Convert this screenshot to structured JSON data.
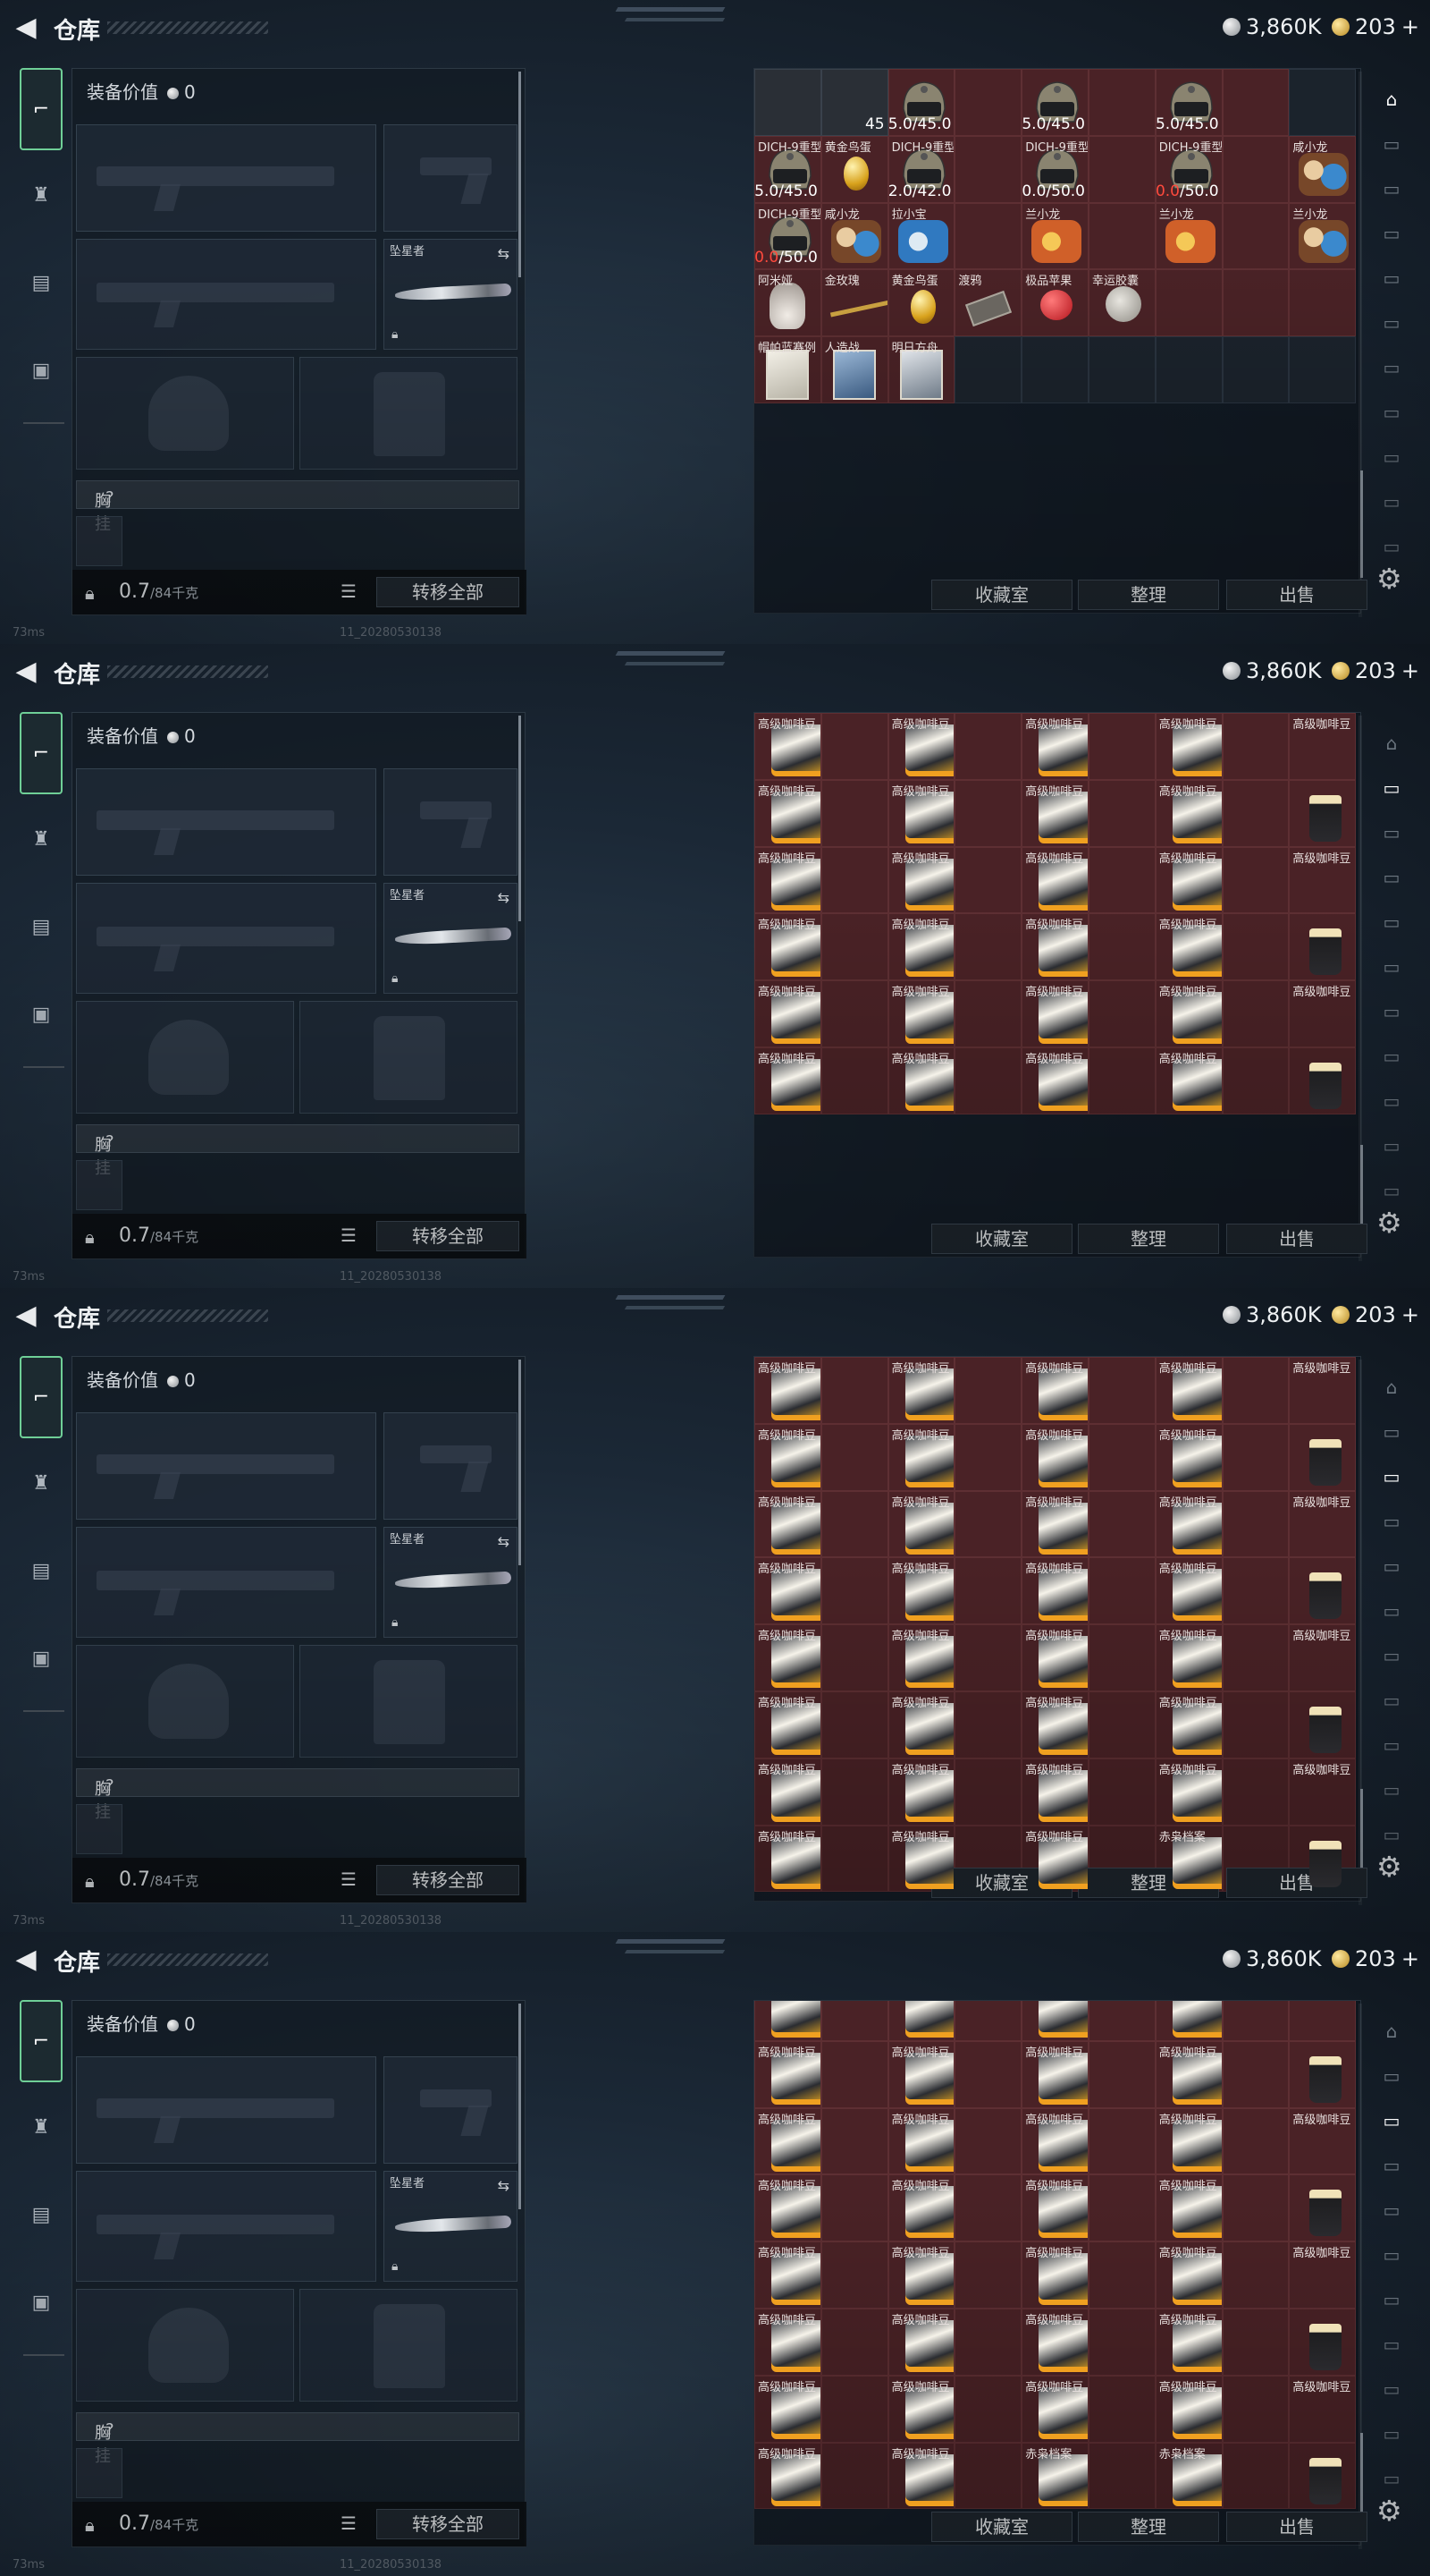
{
  "header": {
    "title": "仓库",
    "silver": "3,860K",
    "gold": "203"
  },
  "equip": {
    "value_label": "装备价值",
    "value": "0",
    "melee_label": "坠星者",
    "chest_label": "胸挂",
    "chest_mark": "?",
    "weight_current": "0.7",
    "weight_max": "/84千克",
    "transfer_label": "转移全部"
  },
  "stash_buttons": {
    "collection": "收藏室",
    "organize": "整理",
    "sell": "出售"
  },
  "status": {
    "ping": "73ms",
    "build": "11_20280530138"
  },
  "icons": {
    "back": "back-arrow-icon",
    "gun": "gun-icon",
    "armor": "armor-icon",
    "backpack": "backpack-icon",
    "case": "case-icon",
    "settings": "gear-icon",
    "lock": "lock-icon",
    "swap": "swap-icon",
    "list": "list-icon"
  },
  "colors": {
    "item_bg": "#4a2226",
    "active_tab": "#6fcf97"
  },
  "frames": [
    {
      "grid": [
        {
          "label": "",
          "item": "dark"
        },
        {
          "label": "",
          "count": "45",
          "item": "dark"
        },
        {
          "label": "",
          "count": "45.0/45.0",
          "item": "helmet"
        },
        {
          "label": "",
          "count": "",
          "item": "cont"
        },
        {
          "label": "",
          "count": "45.0/45.0",
          "item": "helmet"
        },
        {
          "label": "",
          "count": "",
          "item": "cont"
        },
        {
          "label": "",
          "count": "45.0/45.0",
          "item": "helmet"
        },
        {
          "label": "",
          "count": "",
          "item": "cont"
        },
        {
          "label": "",
          "item": "empty"
        },
        {
          "label": "DICH-9重型头盔 三角洲",
          "count": "45.0/45.0",
          "item": "helmet"
        },
        {
          "label": "黄金鸟蛋",
          "item": "egg"
        },
        {
          "label": "DICH-9重型头盔 三角洲",
          "count": "42.0/42.0",
          "item": "helmet"
        },
        {
          "label": "",
          "item": "cont"
        },
        {
          "label": "DICH-9重型头盔 三角洲",
          "count": "30.0/50.0",
          "item": "helmet"
        },
        {
          "label": "",
          "item": "cont"
        },
        {
          "label": "DICH-9重型头盔 三角洲",
          "count_red": "10.0",
          "count": "/50.0",
          "item": "helmet"
        },
        {
          "label": "",
          "item": "cont"
        },
        {
          "label": "咸小龙",
          "item": "toy"
        },
        {
          "label": "DICH-9重型头盔 三角洲",
          "count_red": "0.0",
          "count": "/50.0",
          "item": "helmet"
        },
        {
          "label": "咸小龙",
          "item": "toy"
        },
        {
          "label": "拉小宝",
          "item": "toy-blue"
        },
        {
          "label": "",
          "item": "cont"
        },
        {
          "label": "兰小龙",
          "item": "toy-orange"
        },
        {
          "label": "",
          "item": "cont"
        },
        {
          "label": "兰小龙",
          "item": "toy-orange"
        },
        {
          "label": "",
          "item": "cont"
        },
        {
          "label": "兰小龙",
          "item": "toy"
        },
        {
          "label": "阿米娅",
          "item": "bunny"
        },
        {
          "label": "金玫瑰",
          "item": "rose"
        },
        {
          "label": "黄金鸟蛋",
          "item": "egg"
        },
        {
          "label": "渡鸦",
          "item": "chip"
        },
        {
          "label": "极品苹果",
          "item": "apple"
        },
        {
          "label": "幸运胶囊",
          "item": "moon"
        },
        {
          "label": "",
          "item": "cont"
        },
        {
          "label": "",
          "item": "cont"
        },
        {
          "label": "",
          "item": "cont"
        },
        {
          "label": "帽帕蓝赛例",
          "item": "card"
        },
        {
          "label": "人造战",
          "item": "card-blue"
        },
        {
          "label": "明日方舟",
          "item": "card-gray"
        },
        {
          "label": "",
          "item": "empty"
        },
        {
          "label": "",
          "item": "empty"
        },
        {
          "label": "",
          "item": "empty"
        },
        {
          "label": "",
          "item": "empty"
        },
        {
          "label": "",
          "item": "empty"
        },
        {
          "label": "",
          "item": "empty"
        }
      ]
    },
    {
      "rows": 6
    },
    {
      "rows": 8,
      "last_row_labels": [
        "高级咖啡豆",
        "高级咖啡豆",
        "高级咖啡豆",
        "赤枭档案",
        "赤枭档案",
        "赤枭档案"
      ]
    },
    {
      "rows": 8,
      "partial": true,
      "last_row_labels": [
        "高级咖啡豆",
        "高级咖啡豆",
        "赤枭档案",
        "赤枭档案",
        "赤枭档案",
        "赤枭档案"
      ]
    }
  ],
  "coffee_label": "高级咖啡豆"
}
